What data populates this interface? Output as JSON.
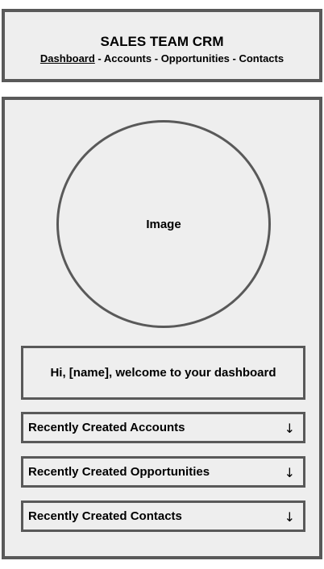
{
  "header": {
    "title": "SALES TEAM CRM",
    "nav": [
      {
        "label": "Dashboard",
        "active": true
      },
      {
        "label": "Accounts"
      },
      {
        "label": "Opportunities"
      },
      {
        "label": "Contacts"
      }
    ],
    "separator": " - "
  },
  "main": {
    "image_placeholder": "Image",
    "welcome_text": "Hi, [name], welcome to your dashboard",
    "sections": [
      {
        "label": "Recently Created Accounts",
        "icon": "down-arrow-icon",
        "arrow": "↓"
      },
      {
        "label": "Recently Created Opportunities",
        "icon": "down-arrow-icon",
        "arrow": "↓"
      },
      {
        "label": "Recently Created Contacts",
        "icon": "down-arrow-icon",
        "arrow": "↓"
      }
    ]
  },
  "colors": {
    "border": "#595959",
    "background": "#eeeeee"
  }
}
